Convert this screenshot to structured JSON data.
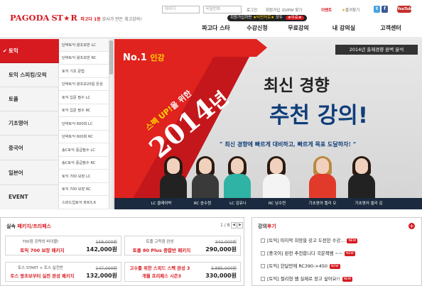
{
  "header": {
    "logo_brand1": "PAGODA",
    "logo_brand2": "ST",
    "logo_brand3": "R",
    "tagline_part1": "파고다 1등",
    "tagline_part2": "강사가 만든 최고강의!",
    "id_placeholder": "아이디",
    "pw_placeholder": "비밀번호",
    "util_links": [
      "로그인",
      "회원가입",
      "ID/PW 찾기",
      "이벤트",
      "즐겨찾기"
    ],
    "join_banner": {
      "text1": "회원가입하면",
      "text2": "★비번처로★",
      "text3": "모두",
      "text4": "★무료★"
    },
    "sns": {
      "twitter": "t",
      "facebook": "f",
      "youtube": "YouTube"
    },
    "gnb": [
      "파고다 스타",
      "수강신청",
      "무료강의",
      "내 강의실",
      "고객센터"
    ]
  },
  "left_nav": {
    "check_icon": "✔",
    "items": [
      "토익",
      "토익 스피킹/오픽",
      "토플",
      "기초영어",
      "중국어",
      "일본어",
      "EVENT"
    ]
  },
  "course_list": [
    "단박토익 왕초보반 LC",
    "단박토익 왕초보반 RC",
    "토익 기초 문법",
    "단박토익 왕초보20일 완성",
    "토익 입문 필수 LC",
    "토익 입문 필수 RC",
    "단박토익 600회 LC",
    "단박토익 600회 RC",
    "송C토익 중급필수 LC",
    "송C토익 중급필수 RC",
    "토익 700 보장 LC",
    "토익 700 보장 RC",
    "스피드업토익 파트5,6"
  ],
  "hero": {
    "badge": "2014년 출제경향 완벽 분석",
    "no1_a": "No.1",
    "no1_b": "인강",
    "spec_a": "스펙 UP!",
    "spec_b": "을 위한",
    "year": "2014",
    "year_suffix": "년",
    "title1": "최신 경향",
    "title2": "추천 강의!",
    "subtitle": "“ 최신 경향에 빠르게 대비하고, 빠르게 목표 도달하자! ”",
    "captions": [
      "LC 클레어박",
      "RC 송수원",
      "LC 김유나",
      "RC 남수연",
      "기초영어 켈리 오",
      "기초영어 셀리 김"
    ]
  },
  "packages": {
    "title_a": "실속",
    "title_b": "패키지/프리패스",
    "page": "1 / 8",
    "prev_icon": "◀",
    "next_icon": "▶",
    "cards": [
      {
        "name1": "700점 공략의 바이블!",
        "name2": "토익 700 보장 패키지",
        "orig": "158,000원",
        "price": "142,000원"
      },
      {
        "name1": "토플 고득점 완성",
        "name2": "토플 80 Plus 종합반 패키지",
        "orig": "342,000원",
        "price": "290,000원"
      },
      {
        "name1": "토스 START + 토스 실전반",
        "name2": "토스 왕초보부터 실전 완성 패키지",
        "orig": "147,000원",
        "price": "132,000원"
      },
      {
        "name1": "고수를 위한 스피드 스펙 완성 3",
        "name2": "개월 프리패스 시즌3",
        "orig": "3,885,000원",
        "price": "330,000원"
      }
    ]
  },
  "reviews": {
    "title_a": "강의",
    "title_b": "후기",
    "plus_icon": "+",
    "new_label": "NEW",
    "items": [
      "[토익] 마지막 희망을 갖고 도전한 수강...",
      "[중국어] 완전 추천합니다 국문책쌤 ~~",
      "[토익] 한달만에 RC390->450",
      "[토익] 절리형 쌤 실제로 정고 싶어요!!"
    ]
  }
}
